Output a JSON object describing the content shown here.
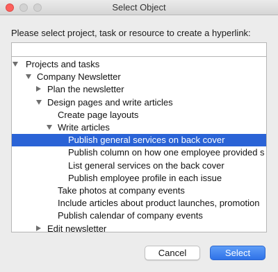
{
  "window": {
    "title": "Select Object",
    "prompt": "Please select project, task or resource to create a hyperlink:"
  },
  "search": {
    "value": "",
    "placeholder": ""
  },
  "tree": {
    "items": [
      {
        "label": "Projects and tasks",
        "level": 0,
        "toggle": "expanded",
        "selected": false
      },
      {
        "label": "Company Newsletter",
        "level": 1,
        "toggle": "expanded",
        "selected": false
      },
      {
        "label": "Plan the newsletter",
        "level": 2,
        "toggle": "collapsed",
        "selected": false
      },
      {
        "label": "Design pages and write articles",
        "level": 2,
        "toggle": "expanded",
        "selected": false
      },
      {
        "label": "Create page layouts",
        "level": 3,
        "toggle": "none",
        "selected": false
      },
      {
        "label": "Write articles",
        "level": 3,
        "toggle": "expanded",
        "selected": false
      },
      {
        "label": "Publish general services on back cover",
        "level": 4,
        "toggle": "none",
        "selected": true
      },
      {
        "label": "Publish column on how one employee provided s",
        "level": 4,
        "toggle": "none",
        "selected": false
      },
      {
        "label": "List general services on the back cover",
        "level": 4,
        "toggle": "none",
        "selected": false
      },
      {
        "label": "Publish employee profile in each issue",
        "level": 4,
        "toggle": "none",
        "selected": false
      },
      {
        "label": "Take photos at company events",
        "level": 3,
        "toggle": "none",
        "selected": false
      },
      {
        "label": "Include articles about product launches, promotion",
        "level": 3,
        "toggle": "none",
        "selected": false
      },
      {
        "label": "Publish calendar of company events",
        "level": 3,
        "toggle": "none",
        "selected": false
      },
      {
        "label": "Edit newsletter",
        "level": 2,
        "toggle": "collapsed",
        "selected": false
      }
    ]
  },
  "buttons": {
    "cancel": "Cancel",
    "select": "Select"
  },
  "colors": {
    "selection": "#2a63d6",
    "primary_button": "#2f72e8",
    "close_button": "#fc605c"
  }
}
